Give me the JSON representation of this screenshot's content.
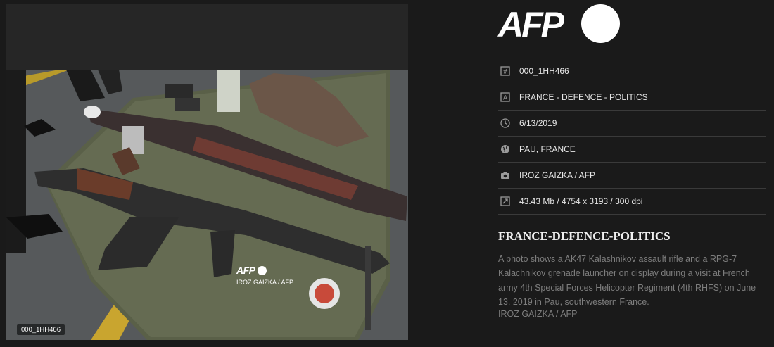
{
  "photo": {
    "id_badge": "000_1HH466",
    "watermark_logo": "AFP",
    "watermark_credit": "IROZ GAIZKA / AFP"
  },
  "brand": {
    "logo_text": "AFP",
    "color": "#ffffff"
  },
  "meta": {
    "id": "000_1HH466",
    "title": "FRANCE - DEFENCE - POLITICS",
    "date": "6/13/2019",
    "location": "PAU, FRANCE",
    "credit": "IROZ GAIZKA / AFP",
    "file_info": "43.43 Mb / 4754 x 3193 / 300 dpi",
    "icons": [
      "id-icon",
      "caption-icon",
      "clock-icon",
      "globe-icon",
      "camera-icon",
      "resize-icon"
    ]
  },
  "caption": {
    "headline": "FRANCE-DEFENCE-POLITICS",
    "body": "A photo shows a AK47 Kalashnikov assault rifle and a RPG-7 Kalachnikov grenade launcher on display during a visit at French army 4th Special Forces Helicopter Regiment (4th RHFS) on June 13, 2019 in Pau, southwestern France.",
    "credit": "IROZ GAIZKA / AFP"
  }
}
